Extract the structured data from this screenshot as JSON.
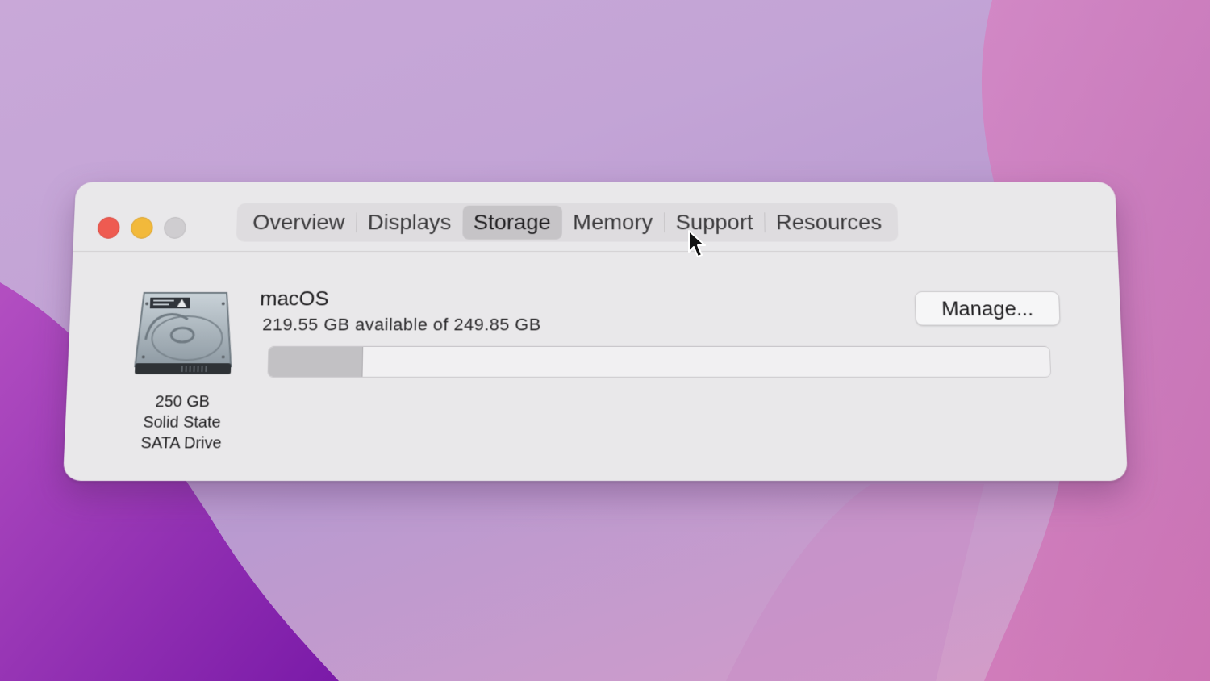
{
  "window": {
    "tabs": [
      {
        "label": "Overview",
        "active": false
      },
      {
        "label": "Displays",
        "active": false
      },
      {
        "label": "Storage",
        "active": true
      },
      {
        "label": "Memory",
        "active": false
      },
      {
        "label": "Support",
        "active": false
      },
      {
        "label": "Resources",
        "active": false
      }
    ]
  },
  "storage": {
    "drive": {
      "icon": "hard-drive-icon",
      "capacity_line": "250 GB",
      "type_line_1": "Solid State",
      "type_line_2": "SATA Drive"
    },
    "volume": {
      "name": "macOS",
      "availability": "219.55 GB available of 249.85 GB",
      "used_fraction": 0.12
    },
    "manage_label": "Manage..."
  },
  "colors": {
    "close": "#ee5b51",
    "minimize": "#f2b93b",
    "zoom": "#cfcdd0",
    "active_tab": "#c6c4c7"
  }
}
